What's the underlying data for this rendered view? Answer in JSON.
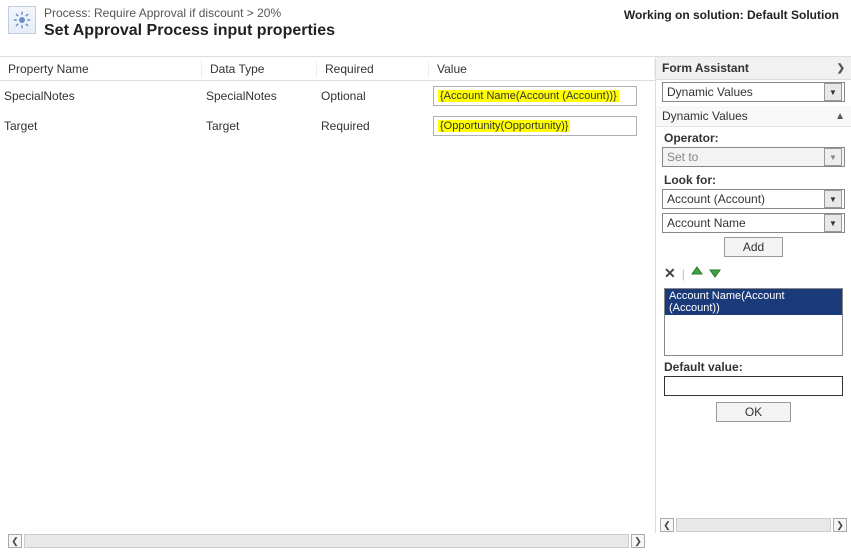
{
  "header": {
    "process_label": "Process: Require Approval if discount > 20%",
    "title": "Set Approval Process input properties",
    "solution_label": "Working on solution: Default Solution"
  },
  "columns": {
    "name": "Property Name",
    "type": "Data Type",
    "required": "Required",
    "value": "Value"
  },
  "rows": [
    {
      "name": "SpecialNotes",
      "type": "SpecialNotes",
      "required": "Optional",
      "value_chip": "{Account Name(Account (Account))}"
    },
    {
      "name": "Target",
      "type": "Target",
      "required": "Required",
      "value_chip": "{Opportunity(Opportunity)}"
    }
  ],
  "assistant": {
    "header": "Form Assistant",
    "dropdown1": "Dynamic Values",
    "section": "Dynamic Values",
    "operator_label": "Operator:",
    "operator_value": "Set to",
    "lookfor_label": "Look for:",
    "lookfor_entity": "Account (Account)",
    "lookfor_field": "Account Name",
    "add_btn": "Add",
    "list_item": "Account Name(Account (Account))",
    "default_label": "Default value:",
    "ok_btn": "OK"
  }
}
